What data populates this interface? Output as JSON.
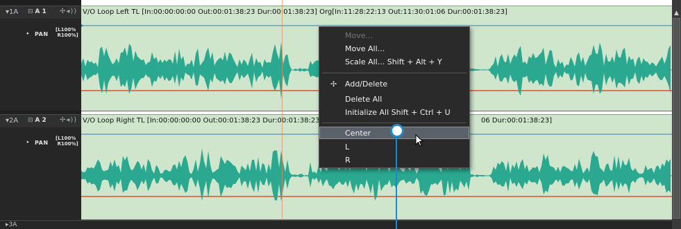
{
  "tracks": [
    {
      "id": "1A",
      "channel": "A 1",
      "clip_title": "V/O Loop Left  TL [In:00:00:00:00 Out:00:01:38:23 Dur:00:01:38:23]  Org[In:11:28:22:13 Out:11:30:01:06 Dur:00:01:38:23]",
      "pan_label": "PAN",
      "pan_value_top": "L100%",
      "pan_value_bottom": "R100%"
    },
    {
      "id": "2A",
      "channel": "A 2",
      "clip_title": "V/O Loop Right  TL [In:00:00:00:00 Out:00:01:38:23 Dur:00:01:38:23]",
      "clip_title_tail": "06 Dur:00:01:38:23]",
      "pan_label": "PAN",
      "pan_value_top": "L100%",
      "pan_value_bottom": "R100%"
    }
  ],
  "bottom_track": {
    "id": "3A"
  },
  "context_menu": {
    "items": [
      {
        "label": "Move...",
        "disabled": true
      },
      {
        "label": "Move All...",
        "disabled": false
      },
      {
        "label": "Scale All...   Shift + Alt + Y",
        "disabled": false
      },
      {
        "label": "Add/Delete",
        "disabled": false,
        "icon": "add-delete-keyframe-icon"
      },
      {
        "label": "Delete All",
        "disabled": false
      },
      {
        "label": "Initialize All  Shift + Ctrl + U",
        "disabled": false
      },
      {
        "label": "Center",
        "disabled": false,
        "highlighted": true
      },
      {
        "label": "L",
        "disabled": false
      },
      {
        "label": "R",
        "disabled": false
      }
    ]
  },
  "colors": {
    "clip_bg": "#cfe6cd",
    "waveform": "#2aa890",
    "callout": "#1e88c8",
    "timeline_cursor": "#d98a5e"
  }
}
